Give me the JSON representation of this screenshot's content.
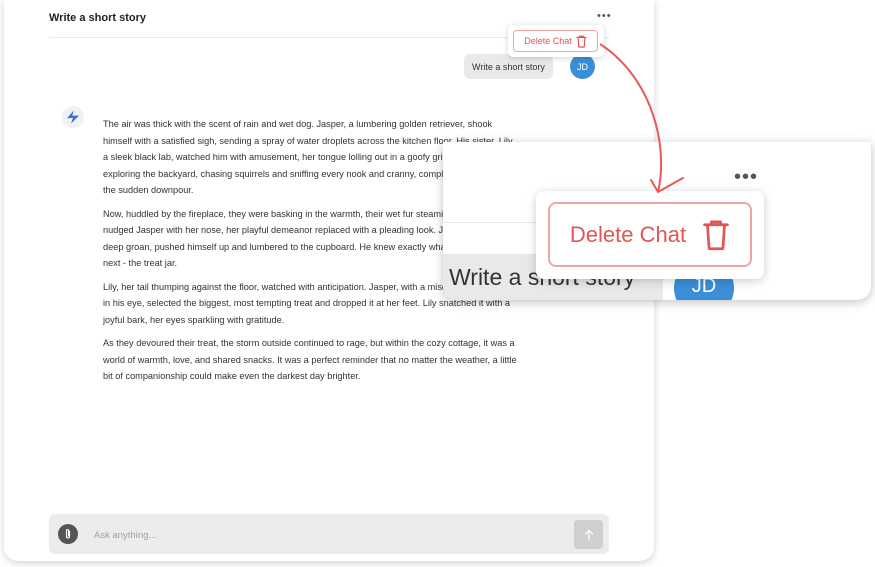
{
  "header": {
    "title": "Write a short story",
    "menu_glyph": "•••",
    "delete_label": "Delete Chat"
  },
  "messages": {
    "user_text": "Write a short story",
    "user_initials": "JD",
    "assistant_paragraphs": [
      "The air was thick with the scent of rain and wet dog. Jasper, a lumbering golden retriever, shook himself with a satisfied sigh, sending a spray of water droplets across the kitchen floor. His sister, Lily, a sleek black lab, watched him with amusement, her tongue lolling out in a goofy grin. They'd been exploring the backyard, chasing squirrels and sniffing every nook and cranny, completely oblivious to the sudden downpour.",
      "Now, huddled by the fireplace, they were basking in the warmth, their wet fur steaming gently. Lily nudged Jasper with her nose, her playful demeanor replaced with a pleading look. Jasper, with a deep groan, pushed himself up and lumbered to the cupboard. He knew exactly what was coming next - the treat jar.",
      "Lily, her tail thumping against the floor, watched with anticipation. Jasper, with a mischievous twinkle in his eye, selected the biggest, most tempting treat and dropped it at her feet. Lily snatched it with a joyful bark, her eyes sparkling with gratitude.",
      "As they devoured their treat, the storm outside continued to rage, but within the cozy cottage, it was a world of warmth, love, and shared snacks. It was a perfect reminder that no matter the weather, a little bit of companionship could make even the darkest day brighter."
    ]
  },
  "composer": {
    "placeholder": "Ask anything..."
  },
  "colors": {
    "accent_blue": "#3b8fd9",
    "delete_red": "#e25555",
    "arrow_red": "#e85a5a"
  },
  "icons": [
    "trash-icon",
    "paperclip-icon",
    "arrow-up-icon",
    "assistant-logo-icon",
    "more-dots-icon"
  ]
}
